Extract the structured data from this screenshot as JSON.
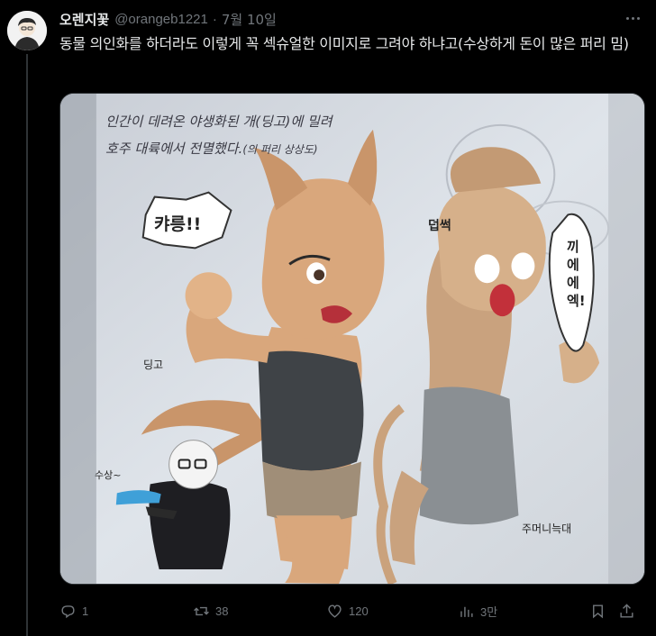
{
  "tweet": {
    "author": {
      "display_name": "오렌지꽃",
      "handle": "@orangeb1221",
      "avatar_icon": "avatar-icon"
    },
    "separator": "·",
    "date": "7월 10일",
    "more_icon": "more-horizontal-icon",
    "text": "동물 의인화를 하더라도 이렇게 꼭 섹슈얼한 이미지로 그려야 하냐고(수상하게 돈이 많은 퍼리 밈)"
  },
  "image": {
    "caption_line1": "인간이 데려온 야생화된 개(딩고)에 밀려",
    "caption_line2": "호주 대륙에서 전멸했다.",
    "caption_line2_small": "(의 퍼리 상상도)",
    "sfx_growl": "캬릉!!",
    "sfx_grab": "덥썩",
    "sfx_scream": "끼에에엑!",
    "label_dingo": "딩고",
    "label_suspicious": "수상~",
    "label_thylacine": "주머니늑대"
  },
  "actions": {
    "reply": {
      "icon": "reply-icon",
      "count": "1"
    },
    "retweet": {
      "icon": "retweet-icon",
      "count": "38"
    },
    "like": {
      "icon": "heart-icon",
      "count": "120"
    },
    "views": {
      "icon": "views-icon",
      "count": "3만"
    },
    "bookmark": {
      "icon": "bookmark-icon"
    },
    "share": {
      "icon": "share-icon"
    }
  },
  "colors": {
    "background": "#000000",
    "text_primary": "#e7e9ea",
    "text_secondary": "#71767b",
    "border": "#2f3336"
  }
}
